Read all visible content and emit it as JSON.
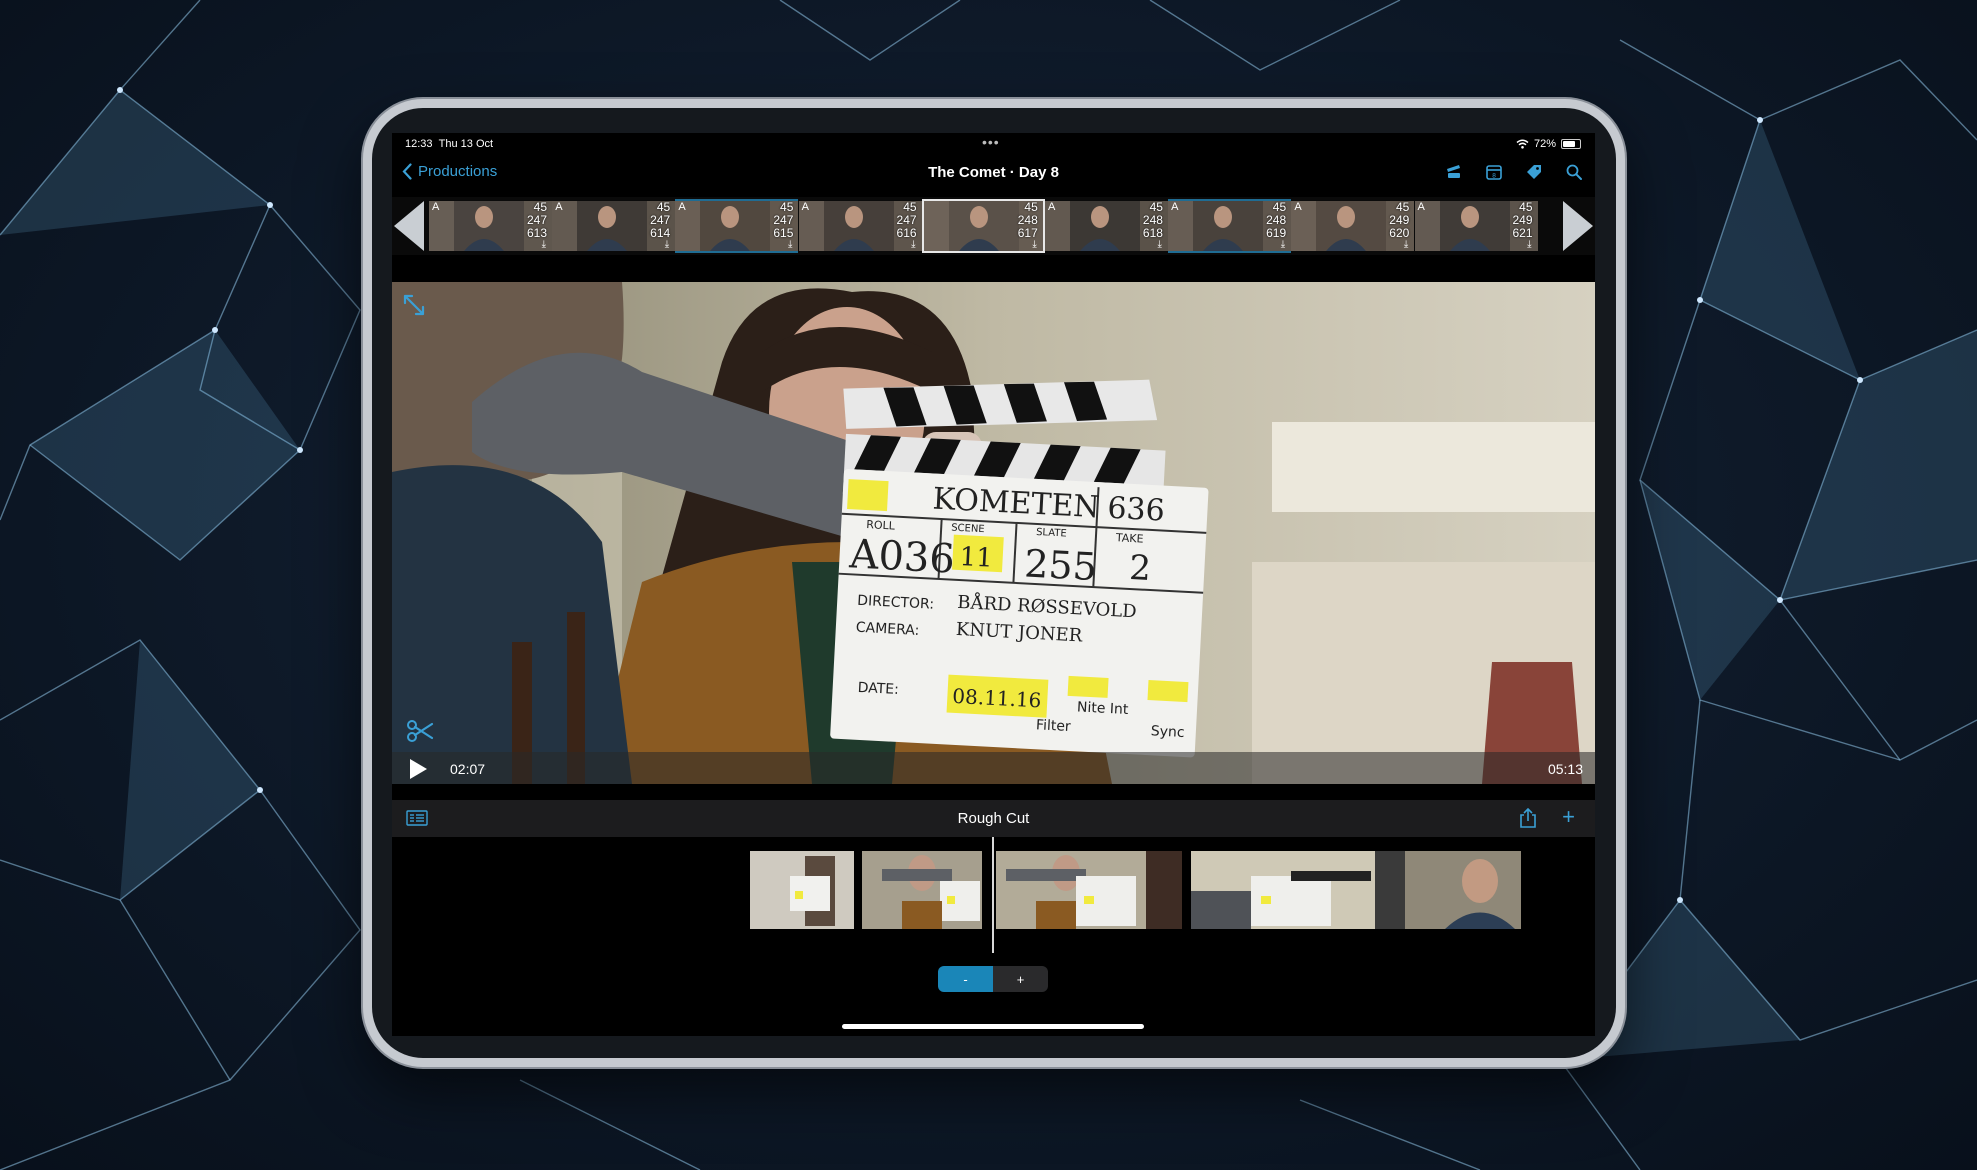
{
  "status_bar": {
    "time": "12:33",
    "date": "Thu 13 Oct",
    "battery": "72%",
    "battery_level": 0.72
  },
  "navbar": {
    "back_label": "Productions",
    "title": "The Comet · Day 8",
    "icons": [
      "slate-icon",
      "calendar-icon",
      "tag-icon",
      "search-icon"
    ]
  },
  "strip": {
    "clips": [
      {
        "cam": "A",
        "scene": "45",
        "slate": "247",
        "take": "613",
        "state": "normal"
      },
      {
        "cam": "A",
        "scene": "45",
        "slate": "247",
        "take": "614",
        "state": "normal"
      },
      {
        "cam": "A",
        "scene": "45",
        "slate": "247",
        "take": "615",
        "state": "blue"
      },
      {
        "cam": "A",
        "scene": "45",
        "slate": "247",
        "take": "616",
        "state": "normal"
      },
      {
        "cam": "",
        "scene": "45",
        "slate": "248",
        "take": "617",
        "state": "selected"
      },
      {
        "cam": "A",
        "scene": "45",
        "slate": "248",
        "take": "618",
        "state": "normal"
      },
      {
        "cam": "A",
        "scene": "45",
        "slate": "248",
        "take": "619",
        "state": "blue"
      },
      {
        "cam": "A",
        "scene": "45",
        "slate": "249",
        "take": "620",
        "state": "normal"
      },
      {
        "cam": "A",
        "scene": "45",
        "slate": "249",
        "take": "621",
        "state": "normal"
      }
    ]
  },
  "player": {
    "current_time": "02:07",
    "total_time": "05:13",
    "slate": {
      "prod": "KOMETEN",
      "prod_no": "636",
      "roll_label": "ROLL",
      "scene_label": "SCENE",
      "slate_label": "SLATE",
      "take_label": "TAKE",
      "roll": "A036",
      "scene": "11",
      "slate_no": "255",
      "take": "2",
      "director_label": "DIRECTOR:",
      "director": "BÅRD RØSSEVOLD",
      "camera_label": "CAMERA:",
      "camera": "KNUT JONER",
      "date_label": "DATE:",
      "date": "08.11.16",
      "nite_int": "Nite Int",
      "filter": "Filter",
      "sync": "Sync"
    }
  },
  "cut": {
    "title": "Rough Cut"
  },
  "zoom": {
    "minus": "-",
    "plus": "+"
  },
  "colors": {
    "accent": "#3aa0d6",
    "selected_blue": "#1a86b8"
  }
}
